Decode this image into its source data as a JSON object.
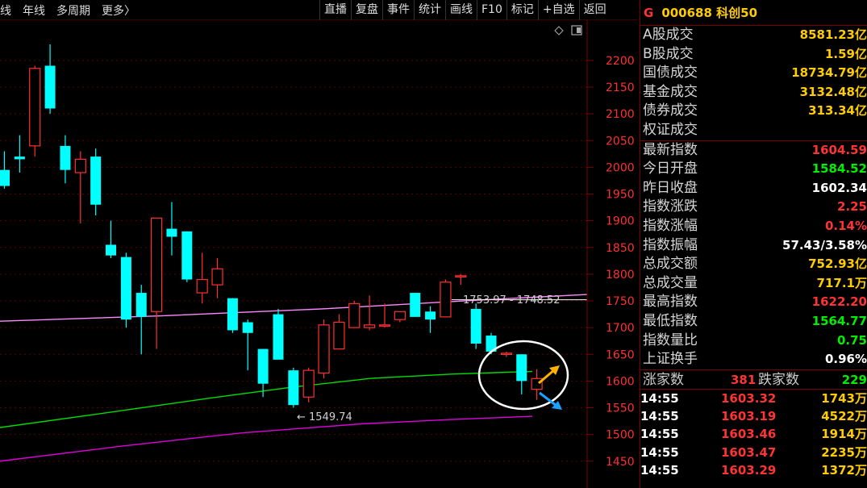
{
  "topbar": {
    "tabs": [
      "线",
      "年线",
      "多周期",
      "更多〉"
    ],
    "tools": [
      "直播",
      "复盘",
      "事件",
      "统计",
      "画线",
      "F10",
      "标记",
      "+自选",
      "返回"
    ]
  },
  "side": {
    "marker": "G",
    "code_name": "000688 科创50",
    "rows1": [
      {
        "label": "A股成交",
        "value": "8581.23亿",
        "color": "#ffcc00"
      },
      {
        "label": "B股成交",
        "value": "1.59亿",
        "color": "#ffcc00"
      },
      {
        "label": "国债成交",
        "value": "18734.79亿",
        "color": "#ffcc00"
      },
      {
        "label": "基金成交",
        "value": "3132.48亿",
        "color": "#ffcc00"
      },
      {
        "label": "债券成交",
        "value": "313.34亿",
        "color": "#ffcc00"
      },
      {
        "label": "权证成交",
        "value": "",
        "color": "#ffcc00"
      }
    ],
    "rows2": [
      {
        "label": "最新指数",
        "value": "1604.59",
        "color": "#ff3333"
      },
      {
        "label": "今日开盘",
        "value": "1584.52",
        "color": "#00ee00"
      },
      {
        "label": "昨日收盘",
        "value": "1602.34",
        "color": "#ffffff"
      },
      {
        "label": "指数涨跌",
        "value": "2.25",
        "color": "#ff3333"
      },
      {
        "label": "指数涨幅",
        "value": "0.14%",
        "color": "#ff3333"
      },
      {
        "label": "指数振幅",
        "value": "57.43/3.58%",
        "color": "#ffffff"
      },
      {
        "label": "总成交额",
        "value": "752.93亿",
        "color": "#ffcc00"
      },
      {
        "label": "总成交量",
        "value": "717.1万",
        "color": "#ffcc00"
      },
      {
        "label": "最高指数",
        "value": "1622.20",
        "color": "#ff3333"
      },
      {
        "label": "最低指数",
        "value": "1564.77",
        "color": "#00ee00"
      },
      {
        "label": "指数量比",
        "value": "0.75",
        "color": "#00ee00"
      },
      {
        "label": "上证换手",
        "value": "0.96%",
        "color": "#ffffff"
      }
    ],
    "updown": {
      "up_label": "涨家数",
      "up_value": "381",
      "down_label": "跌家数",
      "down_value": "229"
    },
    "ticks": [
      {
        "time": "14:55",
        "price": "1603.32",
        "vol": "1743万"
      },
      {
        "time": "14:55",
        "price": "1603.19",
        "vol": "4522万"
      },
      {
        "time": "14:55",
        "price": "1603.46",
        "vol": "1914万"
      },
      {
        "time": "14:55",
        "price": "1603.47",
        "vol": "2235万"
      },
      {
        "time": "14:55",
        "price": "1603.29",
        "vol": "1372万"
      }
    ]
  },
  "chart_data": {
    "type": "candlestick",
    "y_ticks": [
      2200,
      2150,
      2100,
      2050,
      2000,
      1950,
      1900,
      1850,
      1800,
      1750,
      1700,
      1650,
      1600,
      1550,
      1500,
      1450
    ],
    "ylim": [
      1430,
      2230
    ],
    "annotations": {
      "high_label": "1753.97 - 1748.52",
      "low_label": "← 1549.74"
    },
    "candles": [
      {
        "o": 1995,
        "h": 2030,
        "l": 1960,
        "c": 1965
      },
      {
        "o": 2020,
        "h": 2060,
        "l": 1990,
        "c": 2015
      },
      {
        "o": 2040,
        "h": 2190,
        "l": 2020,
        "c": 2185
      },
      {
        "o": 2190,
        "h": 2230,
        "l": 2100,
        "c": 2110
      },
      {
        "o": 2040,
        "h": 2060,
        "l": 1970,
        "c": 1995
      },
      {
        "o": 1990,
        "h": 2030,
        "l": 1895,
        "c": 2015
      },
      {
        "o": 2020,
        "h": 2035,
        "l": 1910,
        "c": 1930
      },
      {
        "o": 1855,
        "h": 1900,
        "l": 1830,
        "c": 1835
      },
      {
        "o": 1832,
        "h": 1840,
        "l": 1700,
        "c": 1715
      },
      {
        "o": 1765,
        "h": 1780,
        "l": 1650,
        "c": 1720
      },
      {
        "o": 1730,
        "h": 1905,
        "l": 1660,
        "c": 1905
      },
      {
        "o": 1885,
        "h": 1935,
        "l": 1835,
        "c": 1870
      },
      {
        "o": 1880,
        "h": 1880,
        "l": 1785,
        "c": 1790
      },
      {
        "o": 1765,
        "h": 1840,
        "l": 1745,
        "c": 1790
      },
      {
        "o": 1780,
        "h": 1830,
        "l": 1755,
        "c": 1810
      },
      {
        "o": 1755,
        "h": 1755,
        "l": 1690,
        "c": 1695
      },
      {
        "o": 1710,
        "h": 1715,
        "l": 1620,
        "c": 1690
      },
      {
        "o": 1660,
        "h": 1660,
        "l": 1570,
        "c": 1595
      },
      {
        "o": 1725,
        "h": 1735,
        "l": 1665,
        "c": 1640
      },
      {
        "o": 1620,
        "h": 1625,
        "l": 1550,
        "c": 1555
      },
      {
        "o": 1570,
        "h": 1625,
        "l": 1560,
        "c": 1620
      },
      {
        "o": 1615,
        "h": 1715,
        "l": 1605,
        "c": 1705
      },
      {
        "o": 1660,
        "h": 1725,
        "l": 1660,
        "c": 1710
      },
      {
        "o": 1700,
        "h": 1750,
        "l": 1700,
        "c": 1745
      },
      {
        "o": 1700,
        "h": 1760,
        "l": 1695,
        "c": 1705
      },
      {
        "o": 1705,
        "h": 1745,
        "l": 1700,
        "c": 1705
      },
      {
        "o": 1715,
        "h": 1730,
        "l": 1710,
        "c": 1730
      },
      {
        "o": 1765,
        "h": 1765,
        "l": 1730,
        "c": 1720
      },
      {
        "o": 1730,
        "h": 1740,
        "l": 1690,
        "c": 1715
      },
      {
        "o": 1720,
        "h": 1790,
        "l": 1720,
        "c": 1785
      },
      {
        "o": 1795,
        "h": 1800,
        "l": 1780,
        "c": 1797
      },
      {
        "o": 1735,
        "h": 1745,
        "l": 1660,
        "c": 1670
      },
      {
        "o": 1685,
        "h": 1690,
        "l": 1650,
        "c": 1655
      },
      {
        "o": 1650,
        "h": 1655,
        "l": 1645,
        "c": 1652
      },
      {
        "o": 1650,
        "h": 1650,
        "l": 1575,
        "c": 1600
      },
      {
        "o": 1584.52,
        "h": 1622.2,
        "l": 1564.77,
        "c": 1604.59
      }
    ],
    "colors": {
      "up": "#ff3030",
      "down": "#00ffff",
      "ma_pink": "#ff88ff",
      "ma_green": "#00dd00",
      "ma_magenta": "#dd00dd",
      "grid": "#5a0000"
    }
  }
}
